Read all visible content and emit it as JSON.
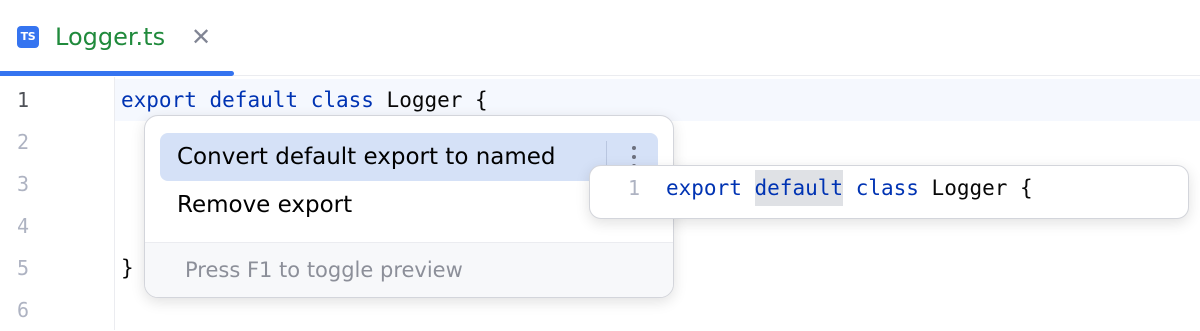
{
  "tab": {
    "icon_label": "TS",
    "title": "Logger.ts",
    "close_glyph": "✕",
    "title_color": "#208a3c",
    "accent": "#3574f0"
  },
  "editor": {
    "line_numbers": [
      "1",
      "2",
      "3",
      "4",
      "5",
      "6"
    ],
    "line1": {
      "kw1": "export",
      "kw2": "default",
      "kw3": "class",
      "rest": " Logger {"
    },
    "line5": "}",
    "keyword_color": "#0033b3"
  },
  "popup": {
    "items": [
      {
        "label": "Convert default export to named",
        "selected": true
      },
      {
        "label": "Remove export",
        "selected": false
      }
    ],
    "more_icon": "vertical-ellipsis-icon",
    "footer": "Press F1 to toggle preview"
  },
  "preview": {
    "line_number": "1",
    "kw1": "export",
    "kw2": "default",
    "kw3": "class",
    "rest": " Logger {"
  }
}
